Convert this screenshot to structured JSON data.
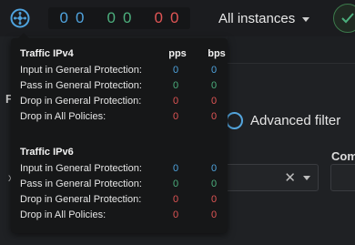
{
  "header": {
    "logo_icon": "network-shield-icon",
    "counters": {
      "blue": [
        "0",
        "0"
      ],
      "green": [
        "0",
        "0"
      ],
      "red": [
        "0",
        "0"
      ]
    },
    "instances_label": "All instances",
    "status_icon": "check-circle-icon"
  },
  "background": {
    "left_fragment_top": "F",
    "left_fragment_bottom": "x",
    "advanced_filter_label": "Advanced filter",
    "com_label": "Com",
    "clear_symbol": "✕"
  },
  "tooltip": {
    "sections": [
      {
        "title": "Traffic IPv4",
        "col_pps": "pps",
        "col_bps": "bps",
        "rows": [
          {
            "label": "Input in General Protection:",
            "pps": "0",
            "bps": "0",
            "color": "#4fa3de"
          },
          {
            "label": "Pass in General Protection:",
            "pps": "0",
            "bps": "0",
            "color": "#4caf7d"
          },
          {
            "label": "Drop in General Protection:",
            "pps": "0",
            "bps": "0",
            "color": "#e05555"
          },
          {
            "label": "Drop in All Policies:",
            "pps": "0",
            "bps": "0",
            "color": "#e05555"
          }
        ]
      },
      {
        "title": "Traffic IPv6",
        "rows": [
          {
            "label": "Input in General Protection:",
            "pps": "0",
            "bps": "0",
            "color": "#4fa3de"
          },
          {
            "label": "Pass in General Protection:",
            "pps": "0",
            "bps": "0",
            "color": "#4caf7d"
          },
          {
            "label": "Drop in General Protection:",
            "pps": "0",
            "bps": "0",
            "color": "#e05555"
          },
          {
            "label": "Drop in All Policies:",
            "pps": "0",
            "bps": "0",
            "color": "#e05555"
          }
        ]
      }
    ]
  },
  "colors": {
    "accent_blue": "#4fa3de",
    "ok_green": "#4caf7d",
    "alert_red": "#e05555"
  }
}
